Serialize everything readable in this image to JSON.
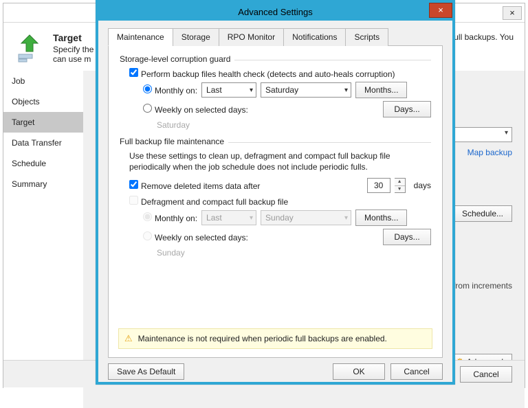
{
  "parent": {
    "title": "Target",
    "subtitle": "Specify the… or full backups. You can use m…",
    "subtitle_left": "Specify the",
    "subtitle_leftb": "can use m",
    "subtitle_right": "or full backups. You",
    "close": "×",
    "sidebar": [
      "Job",
      "Objects",
      "Target",
      "Data Transfer",
      "Schedule",
      "Summary"
    ],
    "map_backup": "Map backup",
    "schedule_btn": "Schedule...",
    "increments": "from increments",
    "advanced_btn": "Advanced",
    "cancel": "Cancel",
    "box_placeholder": ""
  },
  "dlg": {
    "title": "Advanced Settings",
    "close": "×",
    "tabs": [
      "Maintenance",
      "Storage",
      "RPO Monitor",
      "Notifications",
      "Scripts"
    ],
    "g1": {
      "label": "Storage-level corruption guard",
      "chk": "Perform backup files health check (detects and auto-heals corruption)",
      "monthly": "Monthly on:",
      "last": "Last",
      "day": "Saturday",
      "months_btn": "Months...",
      "weekly": "Weekly on selected days:",
      "days_btn": "Days...",
      "sat": "Saturday"
    },
    "g2": {
      "label": "Full backup file maintenance",
      "desc": "Use these settings to clean up, defragment and compact full backup file periodically when the job schedule does not include periodic fulls.",
      "remove": "Remove deleted items data after",
      "days_val": "30",
      "days_word": "days",
      "defrag": "Defragment and compact full backup file",
      "monthly": "Monthly on:",
      "last": "Last",
      "day": "Sunday",
      "months_btn": "Months...",
      "weekly": "Weekly on selected days:",
      "days_btn": "Days...",
      "sun": "Sunday"
    },
    "warn": "Maintenance is not required when periodic full backups are enabled.",
    "save_default": "Save As Default",
    "ok": "OK",
    "cancel": "Cancel"
  }
}
